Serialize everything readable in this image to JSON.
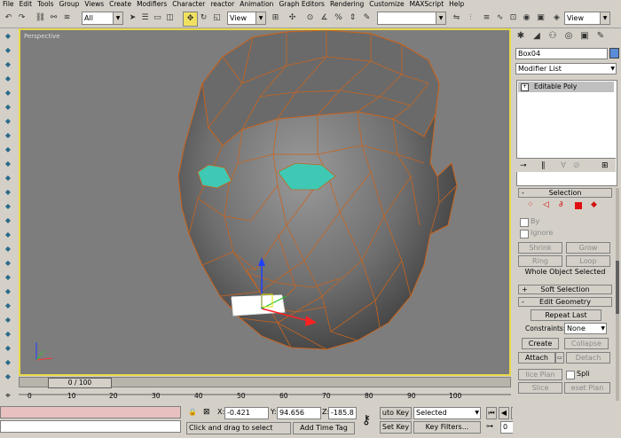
{
  "menu": [
    "File",
    "Edit",
    "Tools",
    "Group",
    "Views",
    "Create",
    "Modifiers",
    "Character",
    "reactor",
    "Animation",
    "Graph Editors",
    "Rendering",
    "Customize",
    "MAXScript",
    "Help"
  ],
  "toolbar": {
    "filter_value": "All",
    "refcoord_value": "View",
    "named_sel_value": "",
    "view_right": "View"
  },
  "viewport": {
    "label": "Perspective"
  },
  "timeslider": {
    "label": "0 / 100"
  },
  "ruler": {
    "ticks": [
      "0",
      "10",
      "20",
      "30",
      "40",
      "50",
      "60",
      "70",
      "80",
      "90",
      "100"
    ]
  },
  "command_panel": {
    "object_name": "Box04",
    "modifier_list": "Modifier List",
    "stack_item": "Editable Poly",
    "selection": {
      "title": "Selection",
      "by_label": "By",
      "ignore_label": "Ignore",
      "shrink": "Shrink",
      "grow": "Grow",
      "ring": "Ring",
      "loop": "Loop",
      "status": "Whole Object Selected"
    },
    "soft_selection": "Soft Selection",
    "edit_geometry": {
      "title": "Edit Geometry",
      "repeat_last": "Repeat Last",
      "constraints_label": "Constraints:",
      "constraints_value": "None",
      "create": "Create",
      "collapse": "Collapse",
      "attach": "Attach",
      "detach": "Detach",
      "slice_plane": "lice Plan",
      "split": "Spli",
      "slice": "Slice",
      "reset_plane": "eset Plan"
    }
  },
  "bottom": {
    "x_label": "X:",
    "x_value": "-0.421",
    "y_label": "Y:",
    "y_value": "94.656",
    "z_label": "Z:",
    "z_value": "-185.8",
    "status_prompt": "Click and drag to select",
    "add_time_tag": "Add Time Tag",
    "auto_key": "uto Key",
    "set_key": "Set Key",
    "selected": "Selected",
    "key_filters": "Key Filters...",
    "frame": "0"
  },
  "colors": {
    "viewport_bg": "#7d7d7d",
    "active_border": "#e8d84a",
    "wire": "#c8641e",
    "eyes": "#3fc8b4"
  }
}
